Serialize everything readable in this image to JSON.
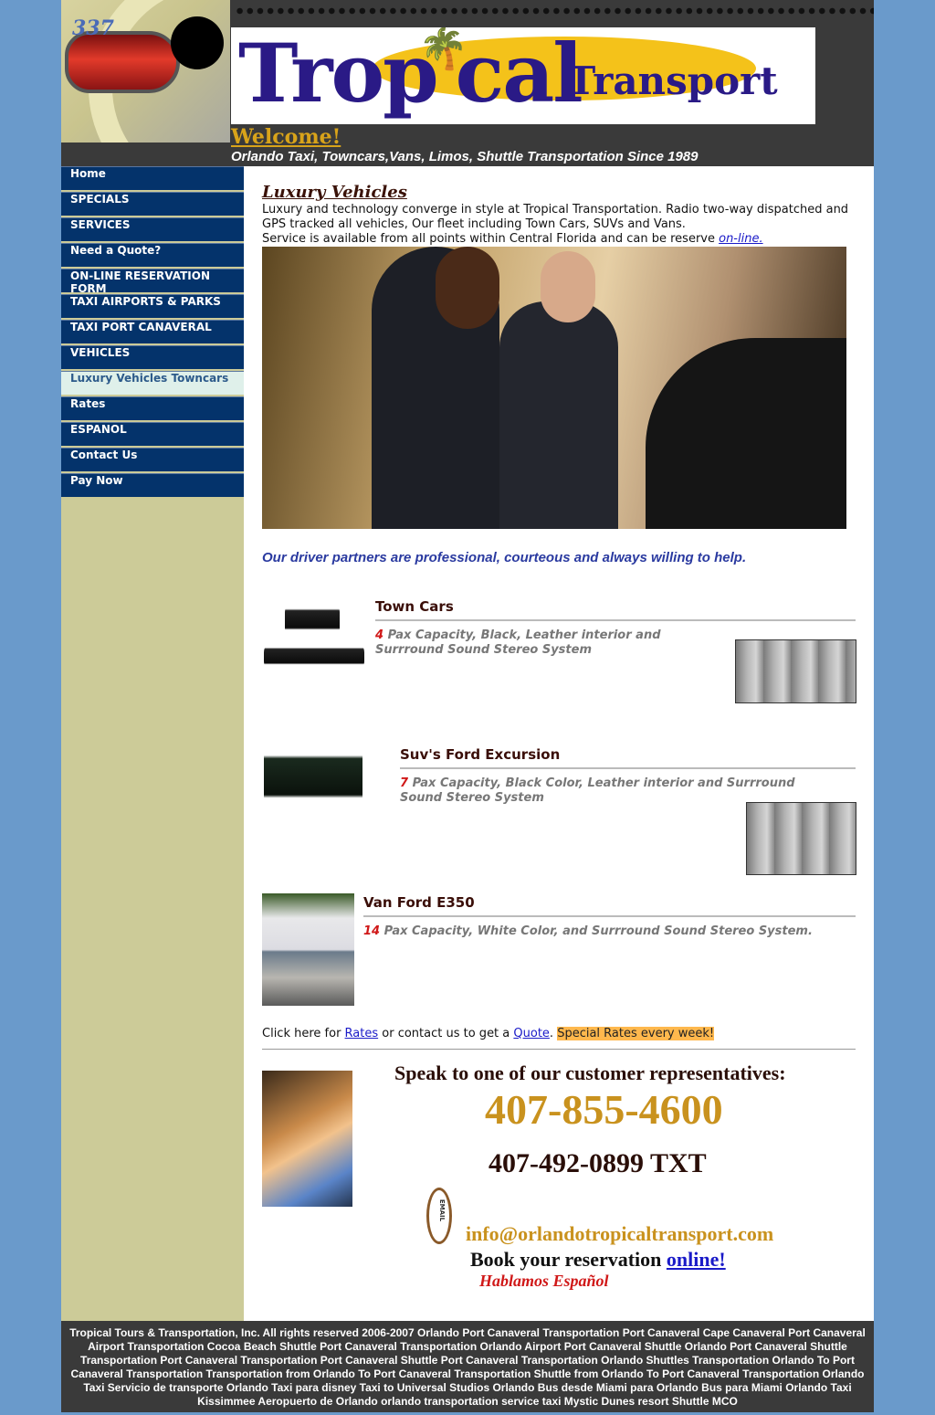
{
  "header": {
    "taxi_number": "337",
    "logo_word_1": "Trop",
    "logo_word_2": "cal",
    "logo_word_3": "Transport",
    "welcome": "Welcome!",
    "tagline": "Orlando Taxi, Towncars,Vans, Limos, Shuttle Transportation Since 1989"
  },
  "sidebar": {
    "items": [
      {
        "label": "Home"
      },
      {
        "label": "SPECIALS"
      },
      {
        "label": "SERVICES"
      },
      {
        "label": "Need a Quote?"
      },
      {
        "label": "ON-LINE RESERVATION FORM"
      },
      {
        "label": "TAXI AIRPORTS & PARKS"
      },
      {
        "label": "TAXI PORT CANAVERAL"
      },
      {
        "label": "VEHICLES"
      },
      {
        "label": "Luxury Vehicles Towncars",
        "active": true
      },
      {
        "label": "Rates"
      },
      {
        "label": "ESPANOL"
      },
      {
        "label": "Contact Us"
      },
      {
        "label": "Pay Now"
      }
    ]
  },
  "main": {
    "title": "Luxury Vehicles",
    "intro_1": "Luxury and technology converge in style at Tropical Transportation. Radio two-way dispatched and GPS tracked all vehicles, Our fleet including Town Cars, SUVs and  Vans.",
    "intro_2": "Service is available from all points within Central Florida and can be reserve ",
    "intro_link": "on-line.",
    "driver_msg": "Our driver partners are professional, courteous and always willing to help.",
    "vehicles": [
      {
        "name": "Town Cars",
        "capacity": "4",
        "desc": " Pax Capacity, Black, Leather interior and Surrround Sound Stereo System"
      },
      {
        "name": "Suv's Ford Excursion",
        "capacity": "7",
        "desc": " Pax Capacity, Black Color, Leather interior and Surrround Sound Stereo System"
      },
      {
        "name": "Van Ford E350",
        "capacity": "14",
        "desc": " Pax Capacity, White Color, and Surrround Sound Stereo System."
      }
    ],
    "rates_line": {
      "pre": "Click here for ",
      "rates_link": "Rates",
      "mid": " or contact us to get a ",
      "quote_link": "Quote",
      "post": ". ",
      "special": "Special Rates every week!"
    },
    "contact": {
      "speak": "Speak to one of our customer representatives:",
      "phone": "407-855-4600",
      "phone_txt": "407-492-0899 TXT",
      "email_badge": "EMAIL",
      "email": "info@orlandotropicaltransport.com",
      "book_pre": "Book your reservation ",
      "book_link": "online!",
      "hablamos": "Hablamos Español"
    }
  },
  "footer": {
    "text": "Tropical Tours & Transportation, Inc. All rights reserved 2006-2007 Orlando Port Canaveral Transportation Port Canaveral Cape Canaveral Port Canaveral Airport Transportation Cocoa Beach Shuttle Port Canaveral Transportation Orlando Airport Port Canaveral Shuttle Orlando Port Canaveral Shuttle Transportation Port Canaveral Transportation Port Canaveral Shuttle Port Canaveral Transportation Orlando Shuttles Transportation Orlando To Port Canaveral Transportation Transportation from Orlando To Port Canaveral Transportation Shuttle from Orlando To Port Canaveral Transportation Orlando Taxi Servicio de transporte Orlando Taxi para disney Taxi to Universal Studios Orlando Bus desde Miami para Orlando Bus para Miami Orlando Taxi Kissimmee Aeropuerto de Orlando orlando transportation service taxi Mystic Dunes resort Shuttle MCO"
  },
  "colors": {
    "page_bg": "#6a9acb",
    "header_bg": "#3a3a3a",
    "nav_bg": "#04336b",
    "sidebar_bg": "#cccb98",
    "accent_gold": "#c9921e",
    "logo_blue": "#2a1a86"
  }
}
